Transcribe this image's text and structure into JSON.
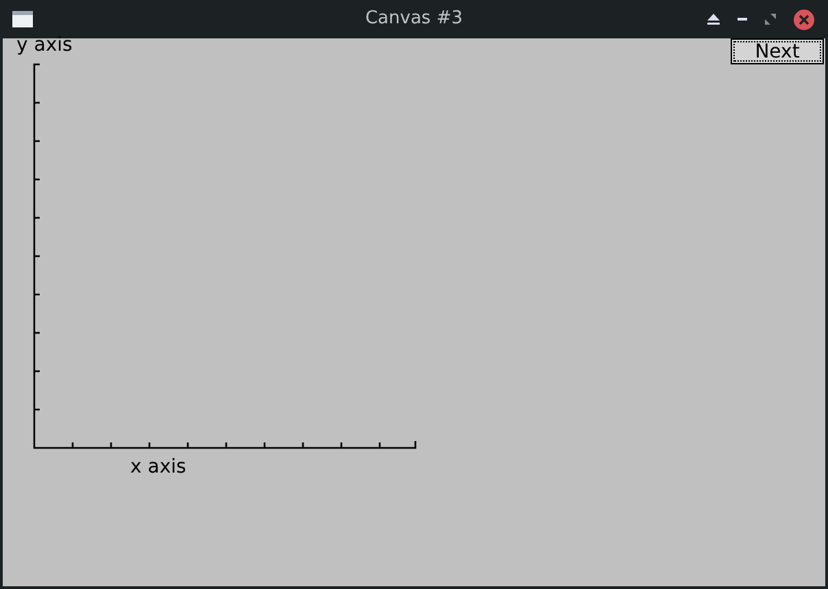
{
  "window": {
    "title": "Canvas #3"
  },
  "canvas": {
    "y_label": "y axis",
    "x_label": "x axis",
    "next_button": "Next"
  }
}
